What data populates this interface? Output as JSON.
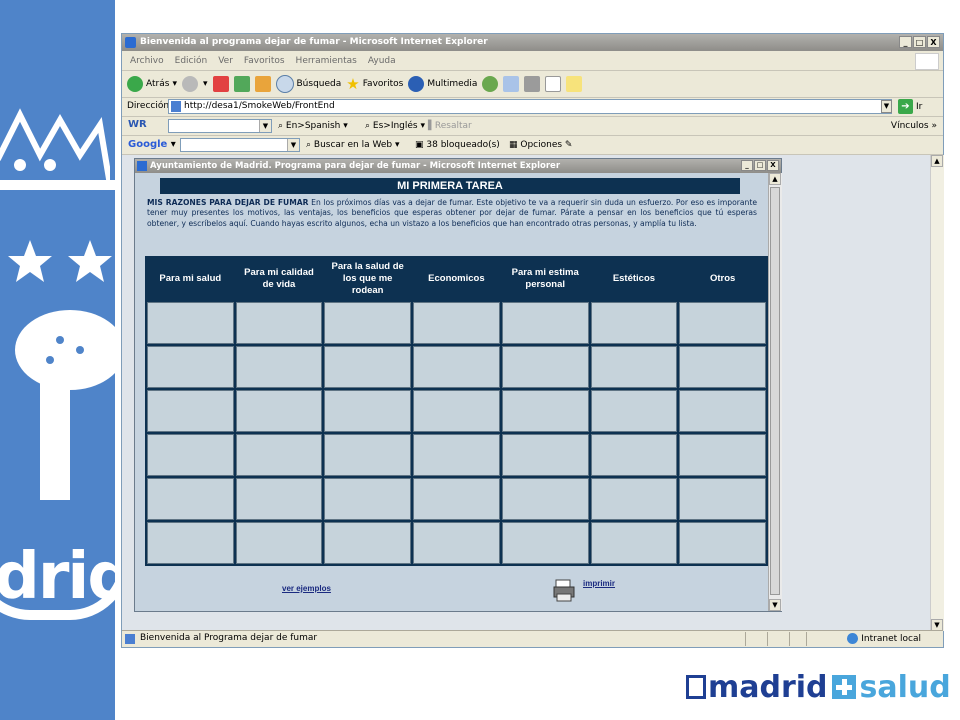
{
  "colors": {
    "banner": "#4f84c9",
    "header_bg": "#0d3151",
    "cell_bg": "#c6d3db",
    "logo_dark": "#1f3f93",
    "logo_light": "#49a6dc"
  },
  "background": {
    "emblem_text": "drid"
  },
  "browser": {
    "title": "Bienvenida al programa dejar de fumar - Microsoft Internet Explorer",
    "window_buttons": [
      "_",
      "□",
      "X"
    ],
    "menu": [
      "Archivo",
      "Edición",
      "Ver",
      "Favoritos",
      "Herramientas",
      "Ayuda"
    ],
    "toolbar": {
      "back": "Atrás",
      "search": "Búsqueda",
      "favorites": "Favoritos",
      "multimedia": "Multimedia"
    },
    "address": {
      "label": "Dirección",
      "url": "http://desa1/SmokeWeb/FrontEnd",
      "go": "Ir"
    },
    "wr_bar": {
      "logo": "WR",
      "en_spanish": "En>Spanish",
      "es_ingles": "Es>Inglés",
      "highlight": "Resaltar",
      "links": "Vínculos"
    },
    "google_bar": {
      "logo": "Google",
      "search_web": "Buscar en la Web",
      "blocked": "38 bloqueado(s)",
      "options": "Opciones"
    },
    "status": {
      "text": "Bienvenida al Programa dejar de fumar",
      "zone": "Intranet local"
    }
  },
  "popup": {
    "title": "Ayuntamiento de Madrid. Programa para dejar de fumar - Microsoft Internet Explorer",
    "heading": "MI PRIMERA TAREA",
    "intro_bold": "MIS RAZONES PARA DEJAR DE FUMAR",
    "intro_text": " En los próximos días vas a dejar de fumar. Este objetivo te va a requerir sin duda un esfuerzo. Por eso es imporante tener muy presentes los motivos, las ventajas, los beneficios que esperas obtener por dejar de fumar. Párate a pensar en los beneficios que tú esperas obtener, y escríbelos aquí. Cuando hayas escrito algunos, echa un vistazo a los beneficios que han encontrado otras personas, y amplía tu lista.",
    "columns": [
      "Para mi salud",
      "Para mi calidad de vida",
      "Para la salud de los que me rodean",
      "Economicos",
      "Para mi estima personal",
      "Estéticos",
      "Otros"
    ],
    "rows": 6,
    "examples_link": "ver ejemplos",
    "print_link": "imprimir"
  },
  "logo": {
    "left": "madrid",
    "right": "salud"
  }
}
